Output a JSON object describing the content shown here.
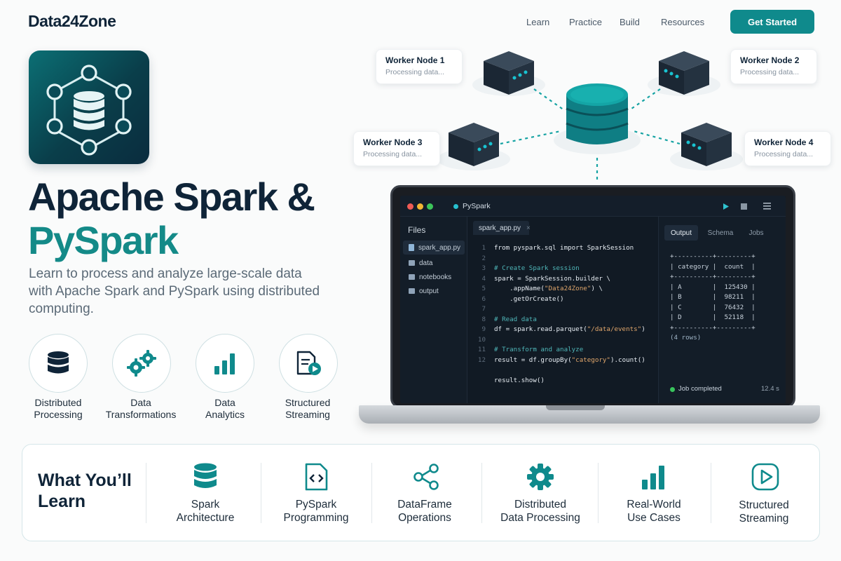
{
  "header": {
    "brand": "Data24Zone",
    "nav": [
      "Learn",
      "Practice",
      "Build",
      "Resources"
    ],
    "cta": "Get Started"
  },
  "hero": {
    "title_line1": "Apache Spark &",
    "title_line2": "PySpark",
    "subtitle": "Learn to process and analyze large-scale data with Apache Spark and PySpark using distributed computing.",
    "features": [
      {
        "label_l1": "Distributed",
        "label_l2": "Processing",
        "icon": "database-icon"
      },
      {
        "label_l1": "Data",
        "label_l2": "Transformations",
        "icon": "gears-icon"
      },
      {
        "label_l1": "Data",
        "label_l2": "Analytics",
        "icon": "bar-chart-icon"
      },
      {
        "label_l1": "Structured",
        "label_l2": "Streaming",
        "icon": "stream-doc-icon"
      }
    ]
  },
  "cluster": {
    "workers": [
      {
        "title": "Worker Node 1",
        "status": "Processing data..."
      },
      {
        "title": "Worker Node 2",
        "status": "Processing data..."
      },
      {
        "title": "Worker Node 3",
        "status": "Processing data..."
      },
      {
        "title": "Worker Node 4",
        "status": "Processing data..."
      }
    ]
  },
  "ide": {
    "app_name": "PySpark",
    "files_heading": "Files",
    "files": [
      "spark_app.py",
      "data",
      "notebooks",
      "output"
    ],
    "open_tab": "spark_app.py",
    "code": [
      {
        "n": "1",
        "parts": [
          [
            "kw",
            "from pyspark.sql import SparkSession"
          ]
        ]
      },
      {
        "n": "2",
        "parts": []
      },
      {
        "n": "3",
        "parts": [
          [
            "cm",
            "# Create Spark session"
          ]
        ]
      },
      {
        "n": "4",
        "parts": [
          [
            "kw",
            "spark = SparkSession.builder \\"
          ]
        ]
      },
      {
        "n": "5",
        "parts": [
          [
            "kw",
            "    .appName("
          ],
          [
            "str",
            "\"Data24Zone\""
          ],
          [
            "kw",
            ") \\"
          ]
        ]
      },
      {
        "n": "6",
        "parts": [
          [
            "kw",
            "    .getOrCreate()"
          ]
        ]
      },
      {
        "n": "7",
        "parts": []
      },
      {
        "n": "8",
        "parts": [
          [
            "cm",
            "# Read data"
          ]
        ]
      },
      {
        "n": "9",
        "parts": [
          [
            "kw",
            "df = spark.read.parquet("
          ],
          [
            "str",
            "\"/data/events\""
          ],
          [
            "kw",
            ")"
          ]
        ]
      },
      {
        "n": "10",
        "parts": []
      },
      {
        "n": "11",
        "parts": [
          [
            "cm",
            "# Transform and analyze"
          ]
        ]
      },
      {
        "n": "12",
        "parts": [
          [
            "kw",
            "result = df.groupBy("
          ],
          [
            "str",
            "\"category\""
          ],
          [
            "kw",
            ").count()"
          ]
        ]
      },
      {
        "n": "",
        "parts": []
      },
      {
        "n": "",
        "parts": [
          [
            "kw",
            "result.show()"
          ]
        ]
      }
    ],
    "output_tabs": [
      "Output",
      "Schema",
      "Jobs"
    ],
    "table_lines": [
      "+----------+---------+",
      "| category |  count  |",
      "+----------+---------+",
      "| A        |  125430 |",
      "| B        |  98211  |",
      "| C        |  76432  |",
      "| D        |  52118  |",
      "+----------+---------+",
      "(4 rows)"
    ],
    "job_status": "Job completed",
    "job_time": "12.4 s"
  },
  "learn": {
    "title_l1": "What You’ll",
    "title_l2": "Learn",
    "items": [
      {
        "l1": "Spark",
        "l2": "Architecture",
        "icon": "database-icon"
      },
      {
        "l1": "PySpark",
        "l2": "Programming",
        "icon": "code-file-icon"
      },
      {
        "l1": "DataFrame",
        "l2": "Operations",
        "icon": "share-nodes-icon"
      },
      {
        "l1": "Distributed",
        "l2": "Data Processing",
        "icon": "gear-icon"
      },
      {
        "l1": "Real-World",
        "l2": "Use Cases",
        "icon": "bar-chart-icon"
      },
      {
        "l1": "Structured",
        "l2": "Streaming",
        "icon": "play-icon"
      }
    ]
  },
  "colors": {
    "teal": "#0f8a8c",
    "navy": "#0f2438",
    "teal_text": "#148a88"
  }
}
